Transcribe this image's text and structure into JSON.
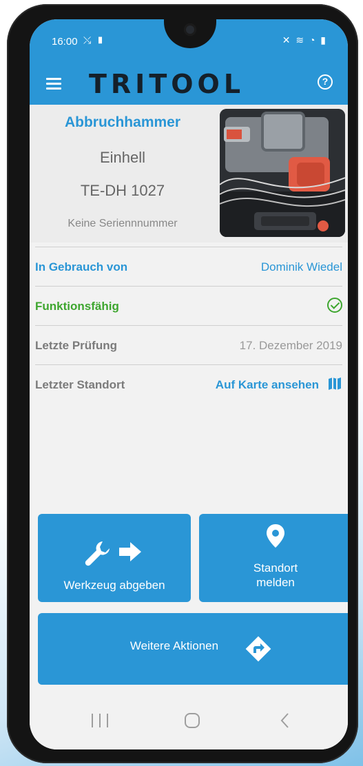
{
  "status_bar": {
    "time": "16:00",
    "left_icons": "⤯ ▮",
    "right_icons": "✕ ≋ ◔ ▮"
  },
  "app_bar": {
    "logo_text": "TRITOOL",
    "menu_icon": "hamburger-menu",
    "help_icon": "question-circle"
  },
  "tool": {
    "name": "Abbruchhammer",
    "brand": "Einhell",
    "model": "TE-DH 1027",
    "serial": "Keine Seriennnummer"
  },
  "details": [
    {
      "label": "In Gebrauch von",
      "value": "Dominik Wiedel"
    },
    {
      "label": "Funktionsfähig",
      "value": ""
    },
    {
      "label": "Letzte Prüfung",
      "value": "17. Dezember 2019"
    },
    {
      "label": "Letzter Standort",
      "value": "Auf Karte ansehen"
    }
  ],
  "actions": {
    "return_label": "Werkzeug abgeben",
    "location_label_line1": "Standort",
    "location_label_line2": "melden",
    "more_label": "Weitere Aktionen"
  },
  "colors": {
    "primary": "#2a96d6",
    "success": "#3ea62f",
    "background": "#f2f2f2"
  }
}
